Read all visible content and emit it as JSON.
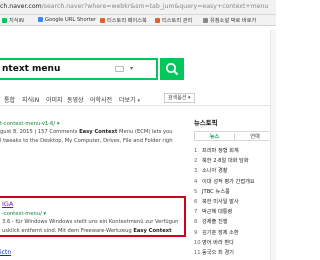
{
  "browser": {
    "url_host": "ch.naver.com",
    "url_path": "/search.naver?where=webkr&sm=tab_jum&query=easy+context+menu"
  },
  "bookmarks": [
    {
      "label": "지식iN",
      "color": "#03c75a"
    },
    {
      "label": "Google URL Shorter",
      "color": "#4285f4"
    },
    {
      "label": "티스토리 페이스북",
      "color": "#e06030"
    },
    {
      "label": "티스토리 관리",
      "color": "#e06030"
    },
    {
      "label": "유첨소설 박로 바로가",
      "color": "#888888"
    }
  ],
  "search": {
    "query": "ntext menu"
  },
  "tabs": [
    {
      "label": "통합",
      "active": false
    },
    {
      "label": "지식iN",
      "active": false
    },
    {
      "label": "이미지",
      "active": false
    },
    {
      "label": "동영상",
      "active": false
    },
    {
      "label": "어학사전",
      "active": false
    },
    {
      "label": "더보기",
      "active": false
    }
  ],
  "search_options_label": "검색옵션",
  "results": [
    {
      "title": "",
      "url": "t-context-menu-v1-6/ ▾",
      "snippet_lines": [
        "gust 8, 2015 | 157 Comments Easy Context Menu (ECM) lets you",
        "l tweaks to the Desktop, My Computer, Drives, File and Folder righ"
      ]
    },
    {
      "title": "IGA",
      "url": "-context-menu/ ▾",
      "snippet_lines": [
        "3.6 - für Windows Windows stellt uns ein Kontextmenü zur Verfügun",
        "usklick entfernt sind. Mit dem Freeware-Werkzeug Easy Context"
      ]
    },
    {
      "title": "ictn"
    }
  ],
  "news_topics": {
    "title": "뉴스토픽",
    "tab_news": "뉴스",
    "tab_entertainment": "연예",
    "items": [
      {
        "rank": "1",
        "text": "프리마 정형 회계"
      },
      {
        "rank": "2",
        "text": "북한 2·8일 대화 담화"
      },
      {
        "rank": "3",
        "text": "소니아 경찰"
      },
      {
        "rank": "4",
        "text": "이대 성적 평가 간접개요"
      },
      {
        "rank": "5",
        "text": "JTBC 뉴스룸"
      },
      {
        "rank": "6",
        "text": "북한 미사일 발사"
      },
      {
        "rank": "7",
        "text": "박근혜 대통령"
      },
      {
        "rank": "8",
        "text": "강제출 진행"
      },
      {
        "rank": "9",
        "text": "김기춘 장제 소환"
      },
      {
        "rank": "10",
        "text": "영어 바라 환다"
      },
      {
        "rank": "11",
        "text": "동국으 최 경기"
      }
    ]
  }
}
